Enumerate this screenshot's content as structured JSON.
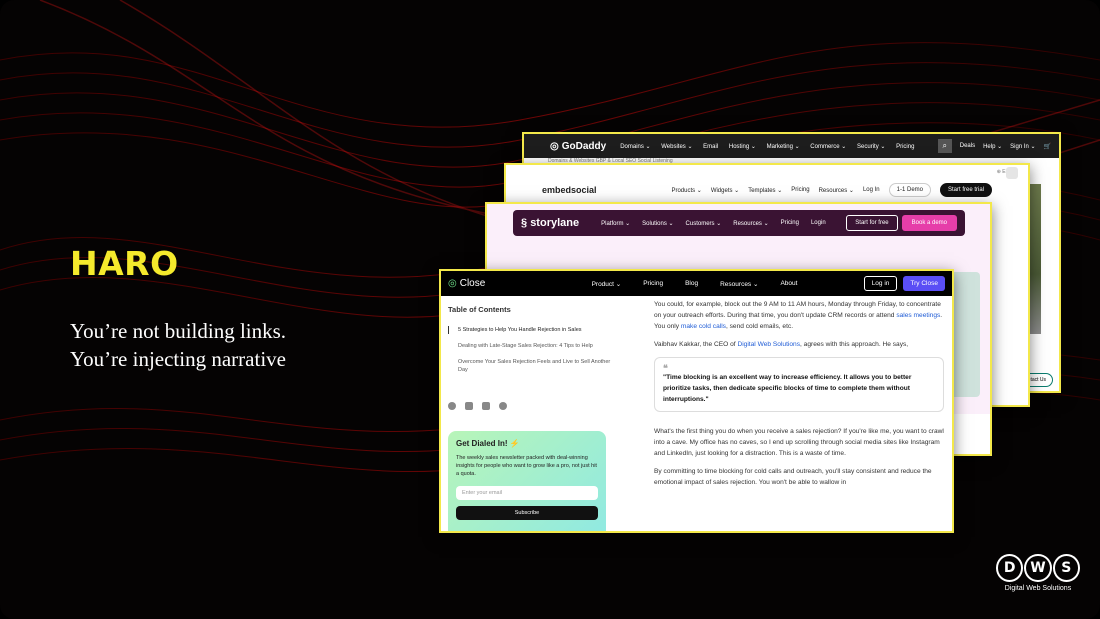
{
  "slide": {
    "title": "HARO",
    "subtitle_line1": "You’re not building links.",
    "subtitle_line2": "You’re injecting narrative",
    "accent_color": "#f5ea2c"
  },
  "godaddy": {
    "logo": "GoDaddy",
    "nav": [
      "Domains ⌄",
      "Websites ⌄",
      "Email",
      "Hosting ⌄",
      "Marketing ⌄",
      "Commerce ⌄",
      "Security ⌄",
      "Pricing"
    ],
    "right": [
      "Deals",
      "Help ⌄",
      "Sign In ⌄"
    ],
    "sub": "Domains & Websites      GBP & Local SEO      Social Listening",
    "lang": "En ⌄",
    "contact_button": "Contact Us"
  },
  "embedsocial": {
    "logo": "embedsocial",
    "nav": [
      "Products ⌄",
      "Widgets ⌄",
      "Templates ⌄",
      "Pricing",
      "Resources ⌄",
      "Log In"
    ],
    "demo": "1-1 Demo",
    "trial": "Start free trial"
  },
  "storylane": {
    "logo": "storylane",
    "nav": [
      "Platform ⌄",
      "Solutions ⌄",
      "Customers ⌄",
      "Resources ⌄",
      "Pricing",
      "Login"
    ],
    "start": "Start for free",
    "demo": "Book a demo"
  },
  "close": {
    "logo": "Close",
    "nav": [
      "Product ⌄",
      "Pricing",
      "Blog",
      "Resources ⌄",
      "About"
    ],
    "login": "Log in",
    "try": "Try Close",
    "toc_title": "Table of Contents",
    "toc": [
      "5 Strategies to Help You Handle Rejection in Sales",
      "Dealing with Late-Stage Sales Rejection: 4 Tips to Help",
      "Overcome Your Sales Rejection Feels and Live to Sell Another Day"
    ],
    "card_title": "Get Dialed In!",
    "card_text": "The weekly sales newsletter packed with deal-winning insights for people who want to grow like a pro, not just hit a quota.",
    "email_placeholder": "Enter your email",
    "subscribe": "Subscribe",
    "p1_a": "You could, for example, block out the 9 AM to 11 AM hours, Monday through Friday, to concentrate on your outreach efforts. During that time, you don't update CRM records or attend ",
    "p1_link1": "sales meetings",
    "p1_b": ". You only ",
    "p1_link2": "make cold calls",
    "p1_c": ", send cold emails, etc.",
    "p2_a": "Vaibhav Kakkar, the CEO of ",
    "p2_link": "Digital Web Solutions",
    "p2_b": ", agrees with this approach. He says,",
    "quote": "\"Time blocking is an excellent way to increase efficiency. It allows you to better prioritize tasks, then dedicate specific blocks of time to complete them without interruptions.\"",
    "p3": "What's the first thing you do when you receive a sales rejection? If you're like me, you want to crawl into a cave. My office has no caves, so I end up scrolling through social media sites like Instagram and LinkedIn, just looking for a distraction. This is a waste of time.",
    "p4": "By committing to time blocking for cold calls and outreach, you'll stay consistent and reduce the emotional impact of sales rejection. You won't be able to wallow in"
  },
  "brand": {
    "letters": [
      "D",
      "W",
      "S"
    ],
    "name": "Digital Web Solutions"
  }
}
